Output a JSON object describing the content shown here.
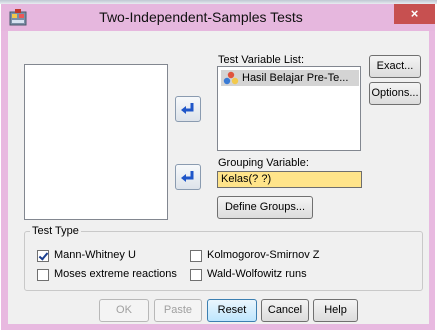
{
  "window": {
    "title": "Two-Independent-Samples Tests",
    "close_symbol": "×"
  },
  "test_variable_list": {
    "label": "Test Variable List:",
    "items": [
      "Hasil Belajar Pre-Te..."
    ]
  },
  "grouping_variable": {
    "label": "Grouping Variable:",
    "value": "Kelas(? ?)"
  },
  "buttons": {
    "exact": "Exact...",
    "options": "Options...",
    "define_groups": "Define Groups...",
    "ok": "OK",
    "paste": "Paste",
    "reset": "Reset",
    "cancel": "Cancel",
    "help": "Help"
  },
  "test_type": {
    "title": "Test Type",
    "options": [
      {
        "label": "Mann-Whitney U",
        "checked": true
      },
      {
        "label": "Kolmogorov-Smirnov Z",
        "checked": false
      },
      {
        "label": "Moses extreme reactions",
        "checked": false
      },
      {
        "label": "Wald-Wolfowitz runs",
        "checked": false
      }
    ]
  },
  "colors": {
    "title_bar": "#e6b7de",
    "close_button": "#c75050",
    "grouping_field": "#ffe48a",
    "dialog_bg": "#f0f0f0"
  }
}
